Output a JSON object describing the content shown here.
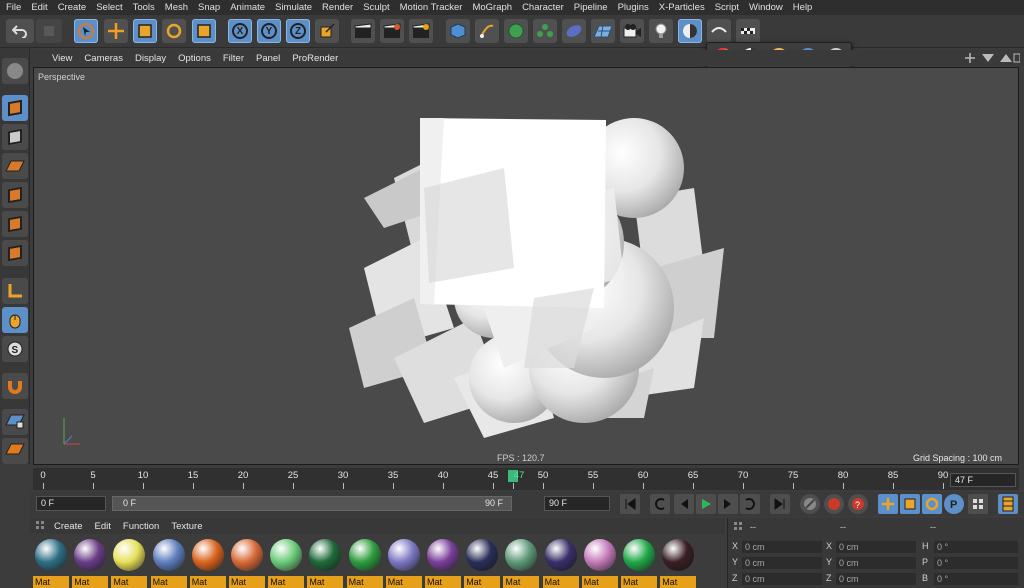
{
  "menu": [
    "File",
    "Edit",
    "Create",
    "Select",
    "Tools",
    "Mesh",
    "Snap",
    "Animate",
    "Simulate",
    "Render",
    "Sculpt",
    "Motion Tracker",
    "MoGraph",
    "Character",
    "Pipeline",
    "Plugins",
    "X-Particles",
    "Script",
    "Window",
    "Help"
  ],
  "toolbar": {
    "axis_x": "X",
    "axis_y": "Y",
    "axis_z": "Z"
  },
  "viewport": {
    "menu": [
      "View",
      "Cameras",
      "Display",
      "Options",
      "Filter",
      "Panel",
      "ProRender"
    ],
    "camera_label": "Perspective",
    "fps": "FPS : 120.7",
    "grid_spacing": "Grid Spacing : 100 cm"
  },
  "timeline": {
    "ticks": [
      "0",
      "5",
      "10",
      "15",
      "20",
      "25",
      "30",
      "35",
      "40",
      "45",
      "47",
      "50",
      "55",
      "60",
      "65",
      "70",
      "75",
      "80",
      "85",
      "90"
    ],
    "current_frame": "47 F"
  },
  "transport": {
    "start": "0 F",
    "range_start": "0 F",
    "range_end": "90 F",
    "end": "90 F"
  },
  "materials": {
    "menu": [
      "Create",
      "Edit",
      "Function",
      "Texture"
    ],
    "label": "Mat",
    "colors": [
      "#2f6f86",
      "#6a3d86",
      "#e6e05a",
      "#5f7fbf",
      "#d9641f",
      "#d96a38",
      "#6ccb7a",
      "#1f6a3a",
      "#2f9d3f",
      "#7d78c4",
      "#7a3f9a",
      "#2a2f5a",
      "#5f9a7a",
      "#3a2f6a",
      "#c47ab8",
      "#22a84a",
      "#3a1f24"
    ]
  },
  "coords": {
    "header": "--",
    "rows": [
      {
        "a": "X",
        "av": "0 cm",
        "b": "X",
        "bv": "0 cm",
        "c": "H",
        "cv": "0 °"
      },
      {
        "a": "Y",
        "av": "0 cm",
        "b": "Y",
        "bv": "0 cm",
        "c": "P",
        "cv": "0 °"
      },
      {
        "a": "Z",
        "av": "0 cm",
        "b": "Z",
        "bv": "0 cm",
        "c": "B",
        "cv": "0 °"
      }
    ]
  },
  "colors": {
    "accent_blue": "#5d8fc9",
    "material_tag": "#e6a019",
    "playhead": "#3bb87a"
  }
}
